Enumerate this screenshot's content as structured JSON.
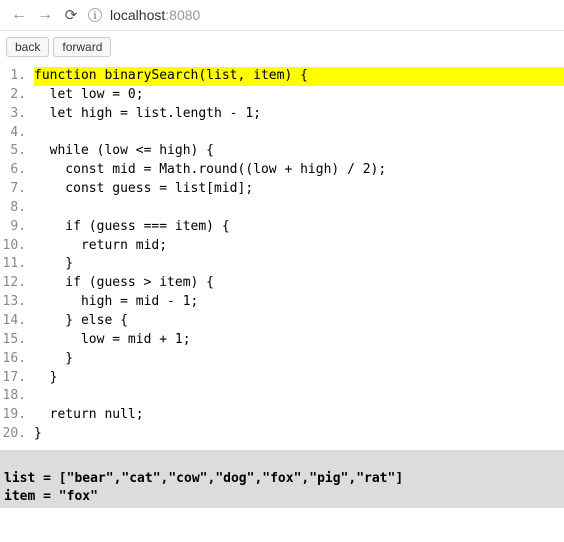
{
  "browser": {
    "back_arrow": "←",
    "forward_arrow": "→",
    "reload": "⟳",
    "info": "i",
    "host": "localhost",
    "port": ":8080"
  },
  "buttons": {
    "back": "back",
    "forward": "forward"
  },
  "code": {
    "lines": [
      {
        "n": "1.",
        "text": "function binarySearch(list, item) {",
        "hl": true
      },
      {
        "n": "2.",
        "text": "  let low = 0;",
        "hl": false
      },
      {
        "n": "3.",
        "text": "  let high = list.length - 1;",
        "hl": false
      },
      {
        "n": "4.",
        "text": "",
        "hl": false
      },
      {
        "n": "5.",
        "text": "  while (low <= high) {",
        "hl": false
      },
      {
        "n": "6.",
        "text": "    const mid = Math.round((low + high) / 2);",
        "hl": false
      },
      {
        "n": "7.",
        "text": "    const guess = list[mid];",
        "hl": false
      },
      {
        "n": "8.",
        "text": "",
        "hl": false
      },
      {
        "n": "9.",
        "text": "    if (guess === item) {",
        "hl": false
      },
      {
        "n": "10.",
        "text": "      return mid;",
        "hl": false
      },
      {
        "n": "11.",
        "text": "    }",
        "hl": false
      },
      {
        "n": "12.",
        "text": "    if (guess > item) {",
        "hl": false
      },
      {
        "n": "13.",
        "text": "      high = mid - 1;",
        "hl": false
      },
      {
        "n": "14.",
        "text": "    } else {",
        "hl": false
      },
      {
        "n": "15.",
        "text": "      low = mid + 1;",
        "hl": false
      },
      {
        "n": "16.",
        "text": "    }",
        "hl": false
      },
      {
        "n": "17.",
        "text": "  }",
        "hl": false
      },
      {
        "n": "18.",
        "text": "",
        "hl": false
      },
      {
        "n": "19.",
        "text": "  return null;",
        "hl": false
      },
      {
        "n": "20.",
        "text": "}",
        "hl": false
      }
    ]
  },
  "output": {
    "line1": "list = [\"bear\",\"cat\",\"cow\",\"dog\",\"fox\",\"pig\",\"rat\"]",
    "line2": "item = \"fox\""
  }
}
